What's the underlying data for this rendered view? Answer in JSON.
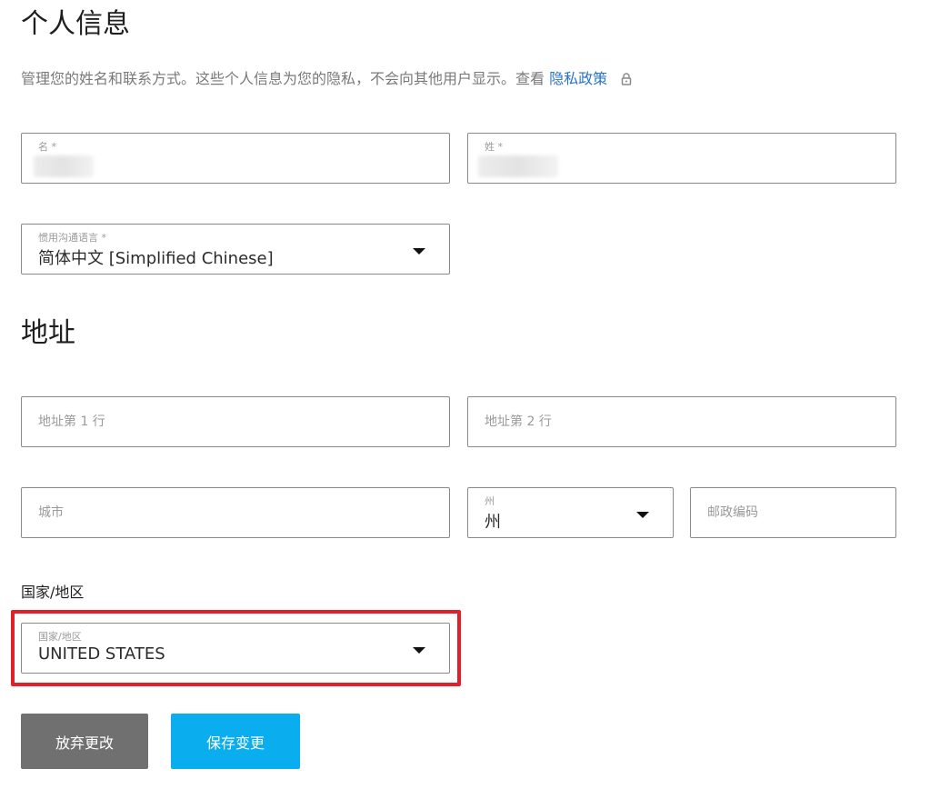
{
  "personal": {
    "title": "个人信息",
    "description": "管理您的姓名和联系方式。这些个人信息为您的隐私，不会向其他用户显示。查看",
    "privacy_link": "隐私政策",
    "first_name_label": "名 *",
    "last_name_label": "姓 *",
    "language_label": "惯用沟通语言 *",
    "language_value": "简体中文 [Simplified Chinese]"
  },
  "address": {
    "title": "地址",
    "line1_placeholder": "地址第 1 行",
    "line2_placeholder": "地址第 2 行",
    "city_placeholder": "城市",
    "state_label": "州",
    "state_value": "州",
    "zip_placeholder": "邮政编码",
    "country_heading": "国家/地区",
    "country_label": "国家/地区",
    "country_value": "UNITED STATES"
  },
  "buttons": {
    "discard": "放弃更改",
    "save": "保存变更"
  },
  "colors": {
    "link": "#2a73c6",
    "highlight": "#e3202a",
    "discard_button": "#707070",
    "save_button": "#0aaeef"
  }
}
